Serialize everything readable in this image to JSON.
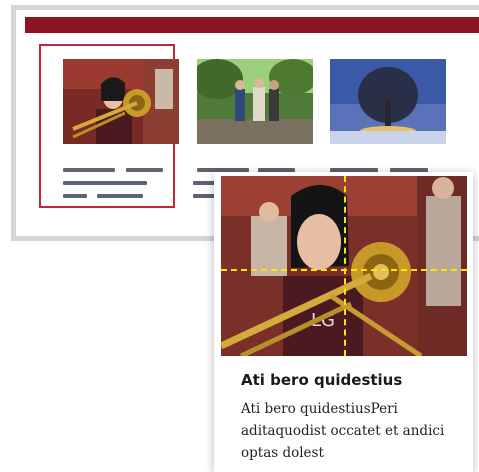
{
  "colors": {
    "header_bar": "#8b1520",
    "selection_outline": "#c2263a",
    "text_placeholder_lines": "#5d6470",
    "focal_crosshair": "#ffe600"
  },
  "gallery": {
    "cards": [
      {
        "image": "trombone-player-photo",
        "selected": true
      },
      {
        "image": "group-of-people-outdoors-photo",
        "selected": false
      },
      {
        "image": "winter-tree-night-photo",
        "selected": false
      }
    ]
  },
  "preview": {
    "image": "trombone-player-photo",
    "title": "Ati bero quidestius",
    "body": "Ati bero quidestiusPeri aditaquodist occatet et andici optas dolest"
  }
}
